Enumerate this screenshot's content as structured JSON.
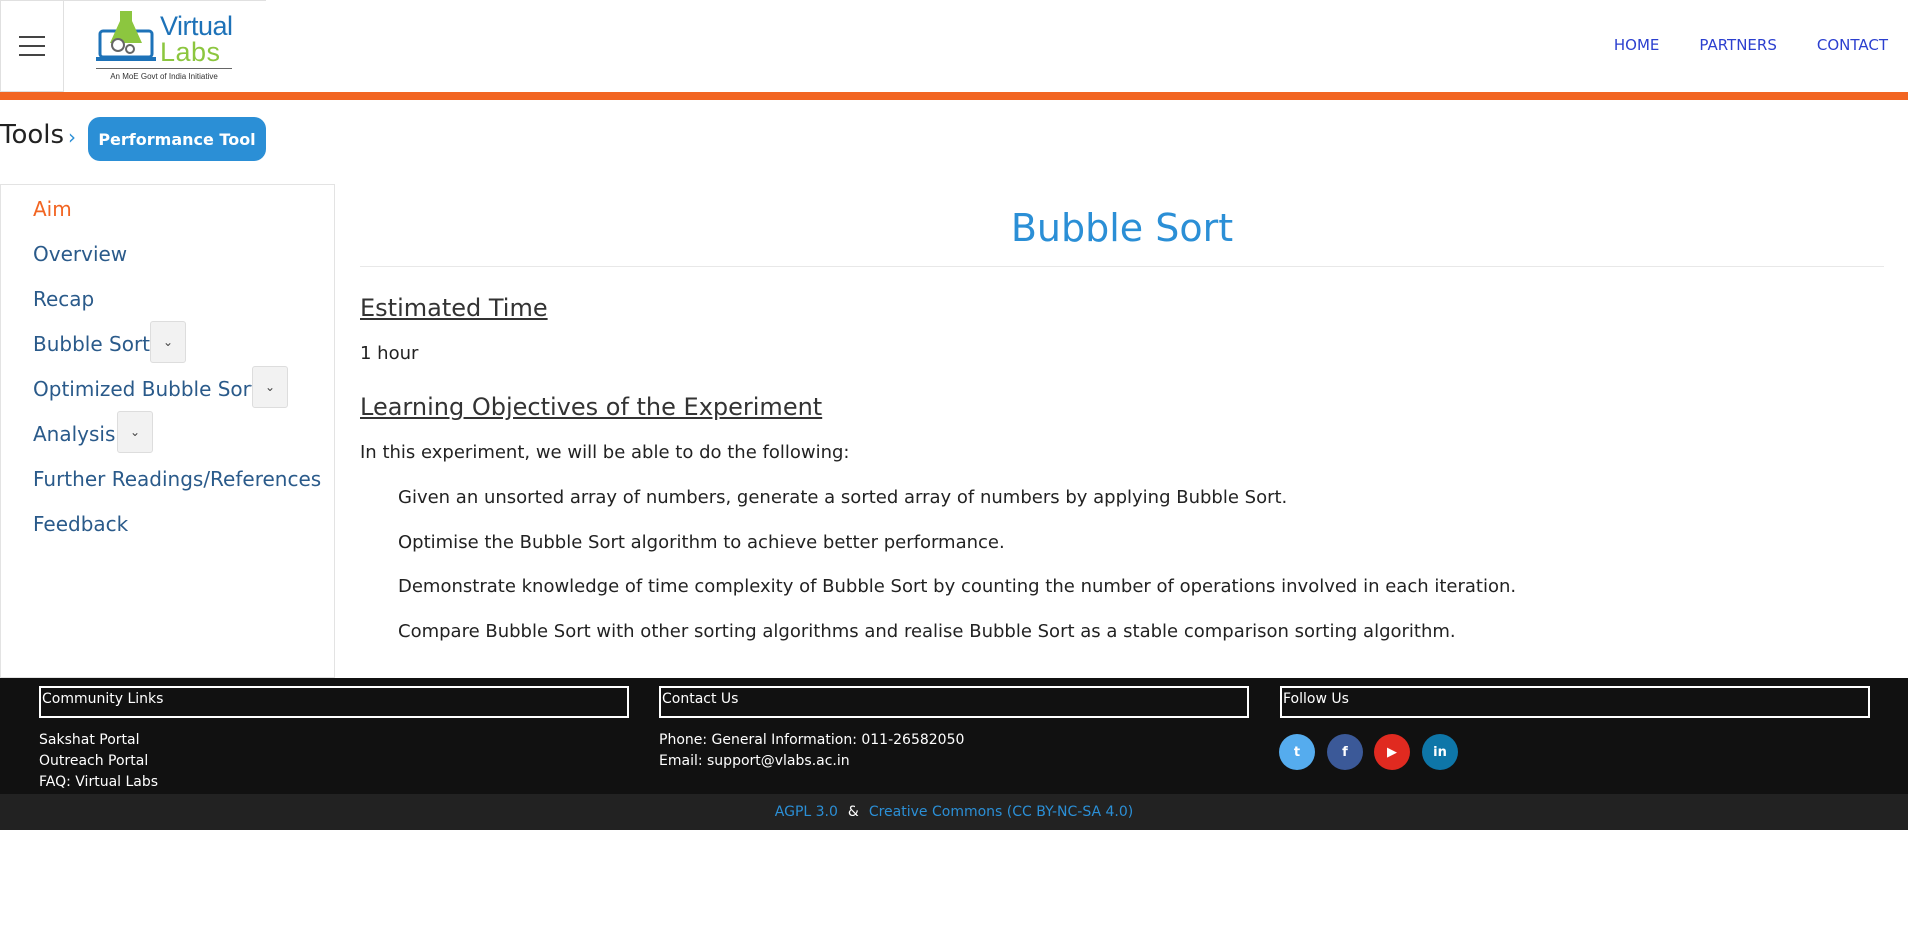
{
  "header": {
    "logo_line1": "Virtual",
    "logo_line2": "Labs",
    "logo_tagline": "An MoE Govt of India Initiative",
    "nav": [
      "HOME",
      "PARTNERS",
      "CONTACT"
    ]
  },
  "breadcrumb": {
    "title": "Tools",
    "chevron": "›",
    "button_label": "Performance Tool"
  },
  "sidebar": {
    "items": [
      {
        "label": "Aim",
        "active": true
      },
      {
        "label": "Overview"
      },
      {
        "label": "Recap"
      },
      {
        "label": "Bubble Sort",
        "dropdown": true
      },
      {
        "label": "Optimized Bubble Sort",
        "dropdown": true
      },
      {
        "label": "Analysis",
        "dropdown": true
      },
      {
        "label": "Further Readings/References"
      },
      {
        "label": "Feedback"
      }
    ],
    "dropdown_glyph": "⌄"
  },
  "content": {
    "title": "Bubble Sort",
    "section1_heading": "Estimated Time",
    "section1_text": "1 hour",
    "section2_heading": "Learning Objectives of the Experiment",
    "section2_intro": "In this experiment, we will be able to do the following:",
    "objectives": [
      "Given an unsorted array of numbers, generate a sorted array of numbers by applying Bubble Sort.",
      "Optimise the Bubble Sort algorithm to achieve better performance.",
      "Demonstrate knowledge of time complexity of Bubble Sort by counting the number of operations involved in each iteration.",
      "Compare Bubble Sort with other sorting algorithms and realise Bubble Sort as a stable comparison sorting algorithm."
    ]
  },
  "footer": {
    "community_heading": "Community Links",
    "community_links": [
      "Sakshat Portal",
      "Outreach Portal",
      "FAQ: Virtual Labs"
    ],
    "contact_heading": "Contact Us",
    "contact_phone": "Phone: General Information: 011-26582050",
    "contact_email": "Email: support@vlabs.ac.in",
    "follow_heading": "Follow Us",
    "social": [
      {
        "name": "twitter-icon",
        "glyph": "t",
        "color": "#55acee"
      },
      {
        "name": "facebook-icon",
        "glyph": "f",
        "color": "#3b5998"
      },
      {
        "name": "youtube-icon",
        "glyph": "▶",
        "color": "#e02a20"
      },
      {
        "name": "linkedin-icon",
        "glyph": "in",
        "color": "#0e76a8"
      }
    ]
  },
  "license": {
    "link1": "AGPL 3.0",
    "amp": "&",
    "link2": "Creative Commons (CC BY-NC-SA 4.0)"
  },
  "colors": {
    "accent_orange": "#f26522",
    "link_blue": "#2b8fd6",
    "nav_blue": "#2b3fcf",
    "footer_bg": "#111111"
  }
}
